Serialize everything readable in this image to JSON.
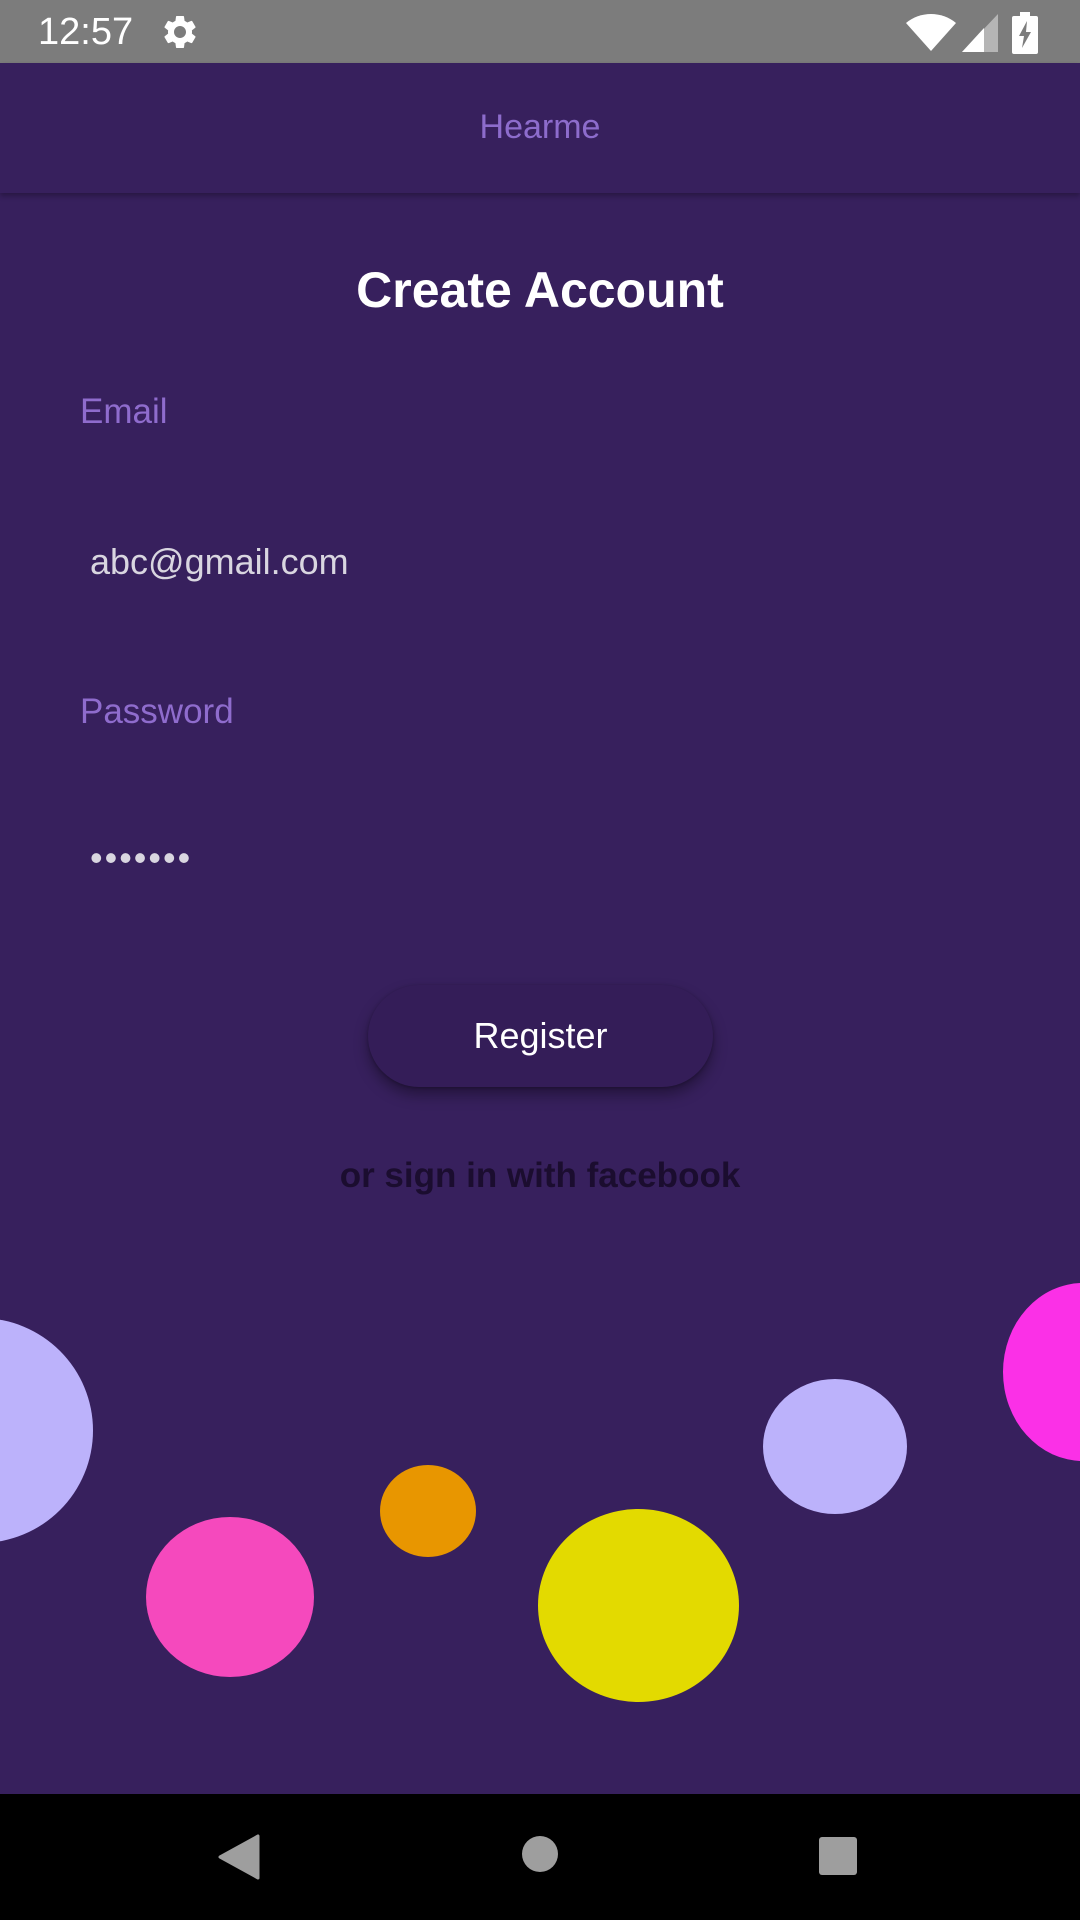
{
  "status_bar": {
    "time": "12:57",
    "icons": [
      "gear-icon",
      "wifi-icon",
      "cell-signal-icon",
      "battery-charging-icon"
    ]
  },
  "app_bar": {
    "title": "Hearme"
  },
  "form": {
    "heading": "Create Account",
    "email_label": "Email",
    "email_value": "abc@gmail.com",
    "password_label": "Password",
    "password_value": "abc1234",
    "register_label": "Register",
    "facebook_link": "or sign in with facebook"
  },
  "nav_bar": {
    "icons": [
      "back-icon",
      "home-icon",
      "recents-icon"
    ]
  },
  "colors": {
    "background": "#37205d",
    "status_bar": "#7c7c7c",
    "accent_purple": "#8d6ccc",
    "bubble_lavender": "#bcb2fb",
    "bubble_pink": "#f549bd",
    "bubble_orange": "#e89600",
    "bubble_yellow": "#e3da00",
    "bubble_magenta": "#fb30e7"
  }
}
